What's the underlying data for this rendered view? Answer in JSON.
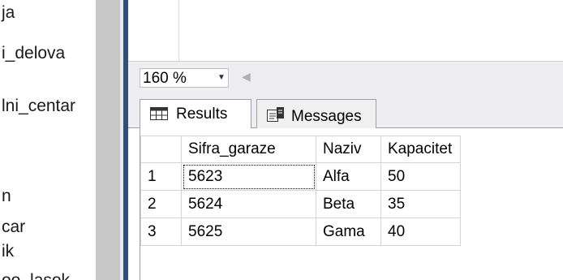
{
  "explorer": {
    "items": [
      "ja",
      "i_delova",
      "lni_centar",
      "n",
      "car",
      "ik",
      "oo_lasok"
    ]
  },
  "statusbar": {
    "zoom_value": "160 %"
  },
  "tabs": [
    {
      "label": "Results",
      "icon": "grid-icon"
    },
    {
      "label": "Messages",
      "icon": "messages-icon"
    }
  ],
  "grid": {
    "columns": [
      "",
      "Sifra_garaze",
      "Naziv",
      "Kapacitet"
    ],
    "rows": [
      {
        "n": "1",
        "sifra": "5623",
        "naziv": "Alfa",
        "kapacitet": "50"
      },
      {
        "n": "2",
        "sifra": "5624",
        "naziv": "Beta",
        "kapacitet": "35"
      },
      {
        "n": "3",
        "sifra": "5625",
        "naziv": "Gama",
        "kapacitet": "40"
      }
    ]
  },
  "colors": {
    "splitter": "#2f4f7a",
    "scrollbar": "#c8c8c8",
    "tab_bar": "#eeeef2"
  }
}
